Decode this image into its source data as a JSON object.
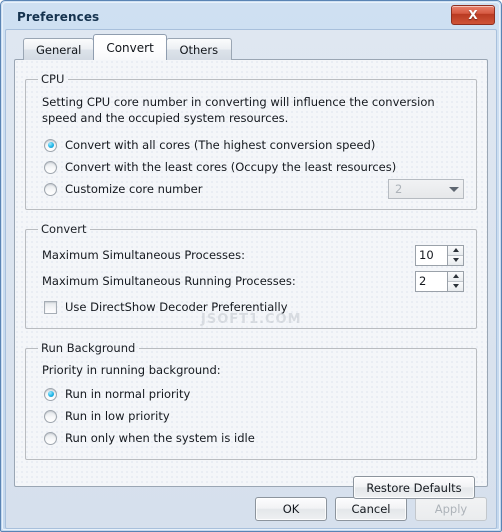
{
  "window": {
    "title": "Preferences",
    "close_label": "X",
    "accent_close": "#c4432a",
    "titlebar_color": "#cfe0f2"
  },
  "tabs": [
    {
      "label": "General",
      "active": false
    },
    {
      "label": "Convert",
      "active": true
    },
    {
      "label": "Others",
      "active": false
    }
  ],
  "cpu": {
    "legend": "CPU",
    "description": "Setting CPU core number in converting will influence the conversion speed and the occupied system resources.",
    "options": [
      {
        "label": "Convert with all cores (The highest conversion speed)",
        "selected": true
      },
      {
        "label": "Convert with the least cores (Occupy the least resources)",
        "selected": false
      },
      {
        "label": "Customize core number",
        "selected": false
      }
    ],
    "core_combo": {
      "value": "2",
      "enabled": false,
      "arrow_icon": "chevron-down-icon"
    }
  },
  "convert": {
    "legend": "Convert",
    "max_processes": {
      "label": "Maximum Simultaneous Processes:",
      "value": "10"
    },
    "max_running_processes": {
      "label": "Maximum Simultaneous Running Processes:",
      "value": "2"
    },
    "directshow": {
      "label": "Use DirectShow Decoder Preferentially",
      "checked": false
    }
  },
  "run_background": {
    "legend": "Run Background",
    "sub_label": "Priority in running background:",
    "options": [
      {
        "label": "Run in normal priority",
        "selected": true
      },
      {
        "label": "Run in low priority",
        "selected": false
      },
      {
        "label": "Run only when the system is idle",
        "selected": false
      }
    ]
  },
  "actions": {
    "restore_defaults": "Restore Defaults",
    "ok": "OK",
    "cancel": "Cancel",
    "apply": "Apply",
    "apply_enabled": false
  },
  "watermark": {
    "text": "JSOFT1.COM"
  }
}
